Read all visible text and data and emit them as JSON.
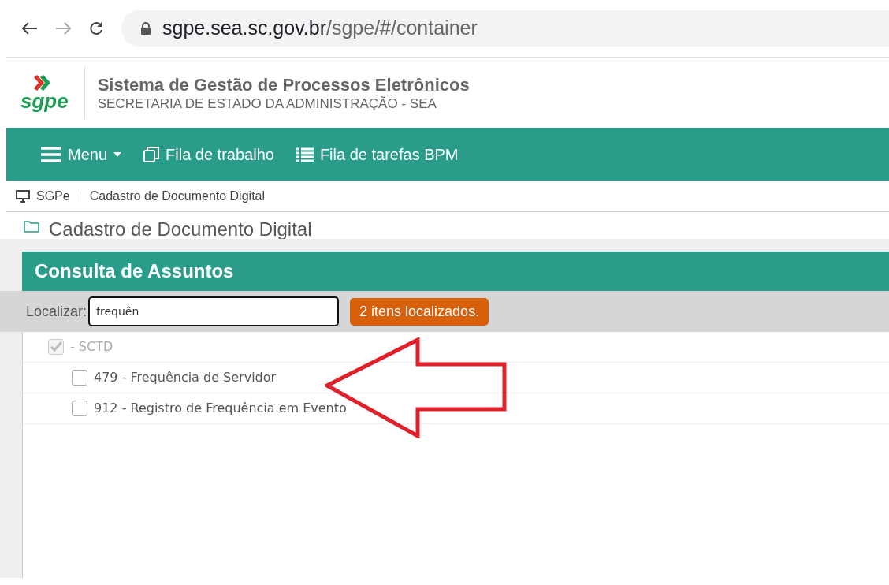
{
  "browser": {
    "url_host": "sgpe.sea.sc.gov.br",
    "url_path": "/sgpe/#/container"
  },
  "header": {
    "logo": "sgpe",
    "title": "Sistema de Gestão de Processos Eletrônicos",
    "subtitle": "SECRETARIA DE ESTADO DA ADMINISTRAÇÃO - SEA"
  },
  "nav": [
    {
      "kind": "menu",
      "label": "Menu"
    },
    {
      "kind": "copy",
      "label": "Fila de trabalho"
    },
    {
      "kind": "list",
      "label": "Fila de tarefas BPM"
    }
  ],
  "breadcrumb": [
    "SGPe",
    "Cadastro de Documento Digital"
  ],
  "page_title": "Cadastro de Documento Digital",
  "dialog": {
    "title": "Consulta de Assuntos",
    "search_label": "Localizar:",
    "search_value": "frequên",
    "result_badge": "2 itens localizados.",
    "tree": [
      {
        "label": "- SCTD",
        "checked": true,
        "disabled": true,
        "children": [
          {
            "label": "479 - Frequência de Servidor",
            "checked": false,
            "disabled": false
          },
          {
            "label": "912 - Registro de Frequência em Evento",
            "checked": false,
            "disabled": false
          }
        ]
      }
    ]
  }
}
